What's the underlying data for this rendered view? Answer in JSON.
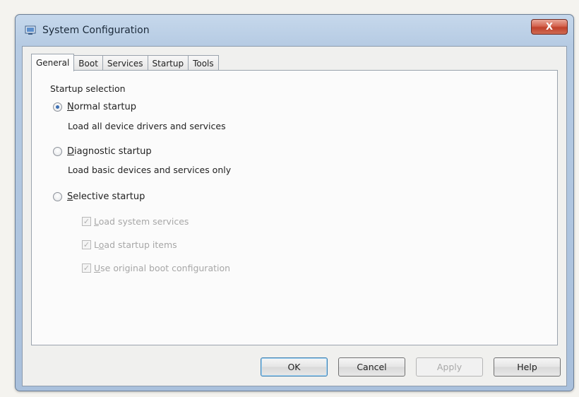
{
  "window": {
    "title": "System Configuration",
    "close_label": "X"
  },
  "tabs": [
    {
      "label": "General",
      "active": true
    },
    {
      "label": "Boot",
      "active": false
    },
    {
      "label": "Services",
      "active": false
    },
    {
      "label": "Startup",
      "active": false
    },
    {
      "label": "Tools",
      "active": false
    }
  ],
  "general": {
    "section_label": "Startup selection",
    "options": [
      {
        "accel": "N",
        "rest": "ormal startup",
        "description": "Load all device drivers and services",
        "selected": true
      },
      {
        "accel": "D",
        "rest": "iagnostic startup",
        "description": "Load basic devices and services only",
        "selected": false
      },
      {
        "accel": "S",
        "rest": "elective startup",
        "description": "",
        "selected": false
      }
    ],
    "selective_options": [
      {
        "pre": "",
        "accel": "L",
        "rest": "oad system services",
        "checked": true,
        "enabled": false
      },
      {
        "pre": "L",
        "accel": "o",
        "rest": "ad startup items",
        "checked": true,
        "enabled": false
      },
      {
        "pre": "",
        "accel": "U",
        "rest": "se original boot configuration",
        "checked": true,
        "enabled": false
      }
    ]
  },
  "buttons": {
    "ok": "OK",
    "cancel": "Cancel",
    "apply": "Apply",
    "help": "Help"
  },
  "colors": {
    "title_bar": "#b6cbe3",
    "close_button": "#c8503a",
    "default_button_border": "#3c7fb1",
    "disabled_text": "#a7a7a7"
  }
}
